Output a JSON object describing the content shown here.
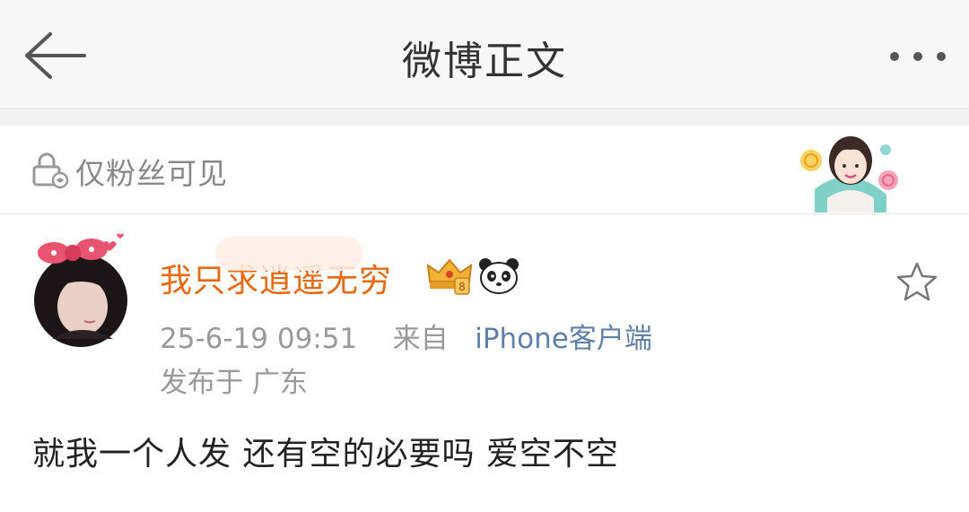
{
  "header": {
    "back_icon": "arrow-left-icon",
    "title": "微博正文",
    "more_icon": "more-dots-icon"
  },
  "visibility": {
    "icon": "lock-person-icon",
    "label": "仅粉丝可见"
  },
  "post": {
    "username": "我只求逍遥无穷",
    "badges": [
      "crown-badge-icon",
      "panda-icon"
    ],
    "star_icon": "star-outline-icon",
    "time": "25-6-19 09:51",
    "from_label": "来自",
    "source": "iPhone客户端",
    "location": "发布于 广东",
    "text": "就我一个人发 还有空的必要吗 爱空不空"
  },
  "colors": {
    "username": "#e8680f",
    "source_link": "#5f7fa8",
    "meta": "#999999",
    "topbar_bg": "#f7f7f7"
  }
}
